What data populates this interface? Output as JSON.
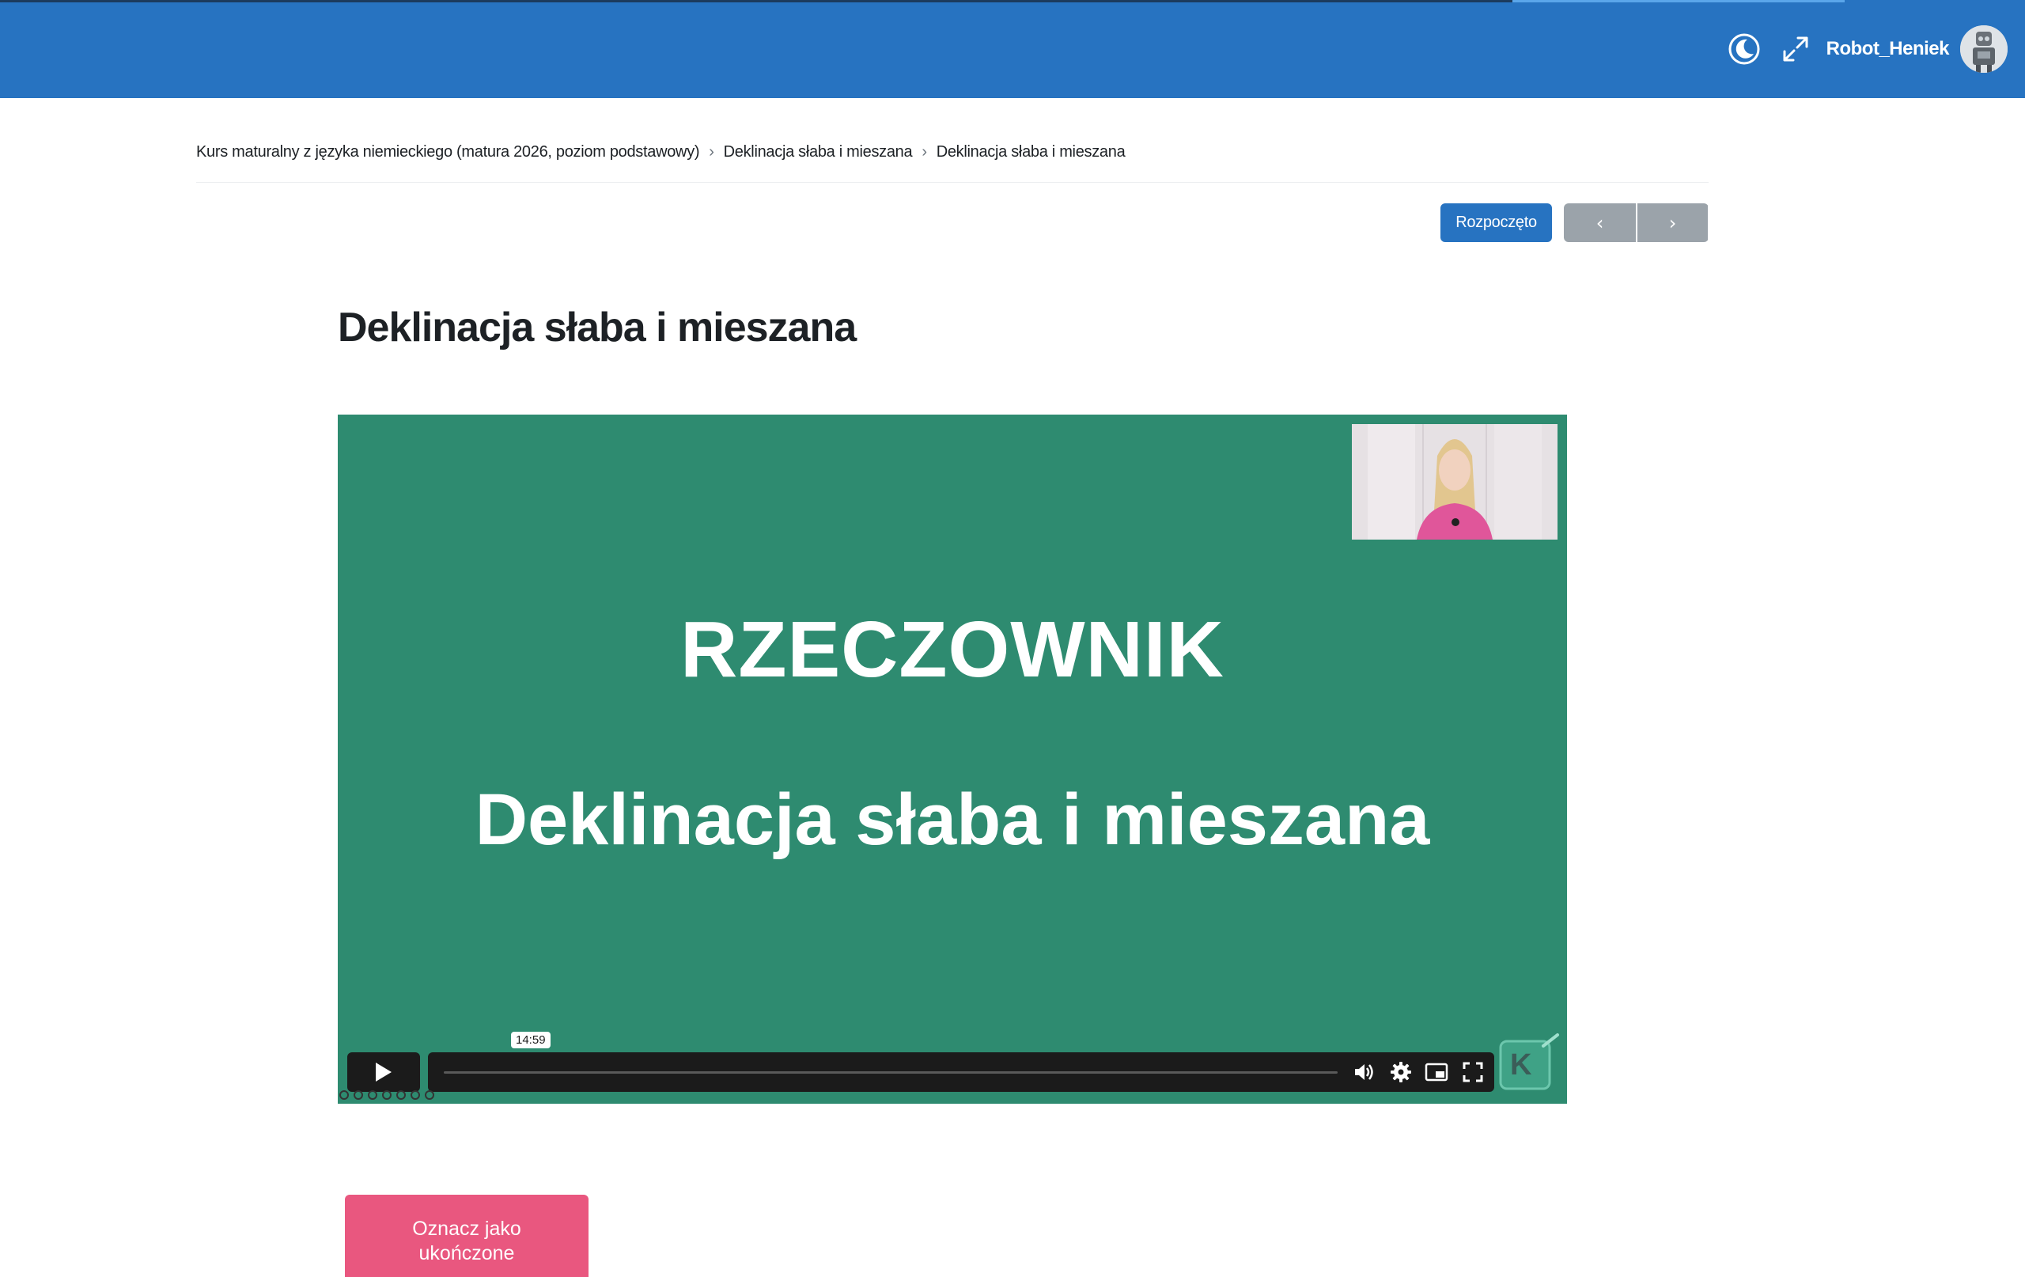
{
  "header": {
    "user_name": "Robot_Heniek",
    "icons": {
      "theme_toggle": "moon-icon",
      "fullscreen": "expand-icon",
      "avatar": "robot-avatar"
    },
    "colors": {
      "bar": "#2773c1",
      "text": "#ffffff"
    }
  },
  "breadcrumb": [
    "Kurs maturalny z języka niemieckiego (matura 2026, poziom podstawowy)",
    "Deklinacja słaba i mieszana",
    "Deklinacja słaba i mieszana"
  ],
  "actions": {
    "status_button": "Rozpoczęto",
    "prev_label": "‹",
    "next_label": "›"
  },
  "page": {
    "title": "Deklinacja słaba i mieszana"
  },
  "video": {
    "slide_heading": "RZECZOWNIK",
    "slide_subheading": "Deklinacja słaba i mieszana",
    "duration_tooltip": "14:59",
    "progress": 0,
    "colors": {
      "background": "#2e8b70",
      "controls": "#1b1b1b"
    },
    "brand_logo_letter": "K"
  },
  "complete_button": {
    "label": "Oznacz jako ukończone",
    "color": "#e9577f"
  }
}
